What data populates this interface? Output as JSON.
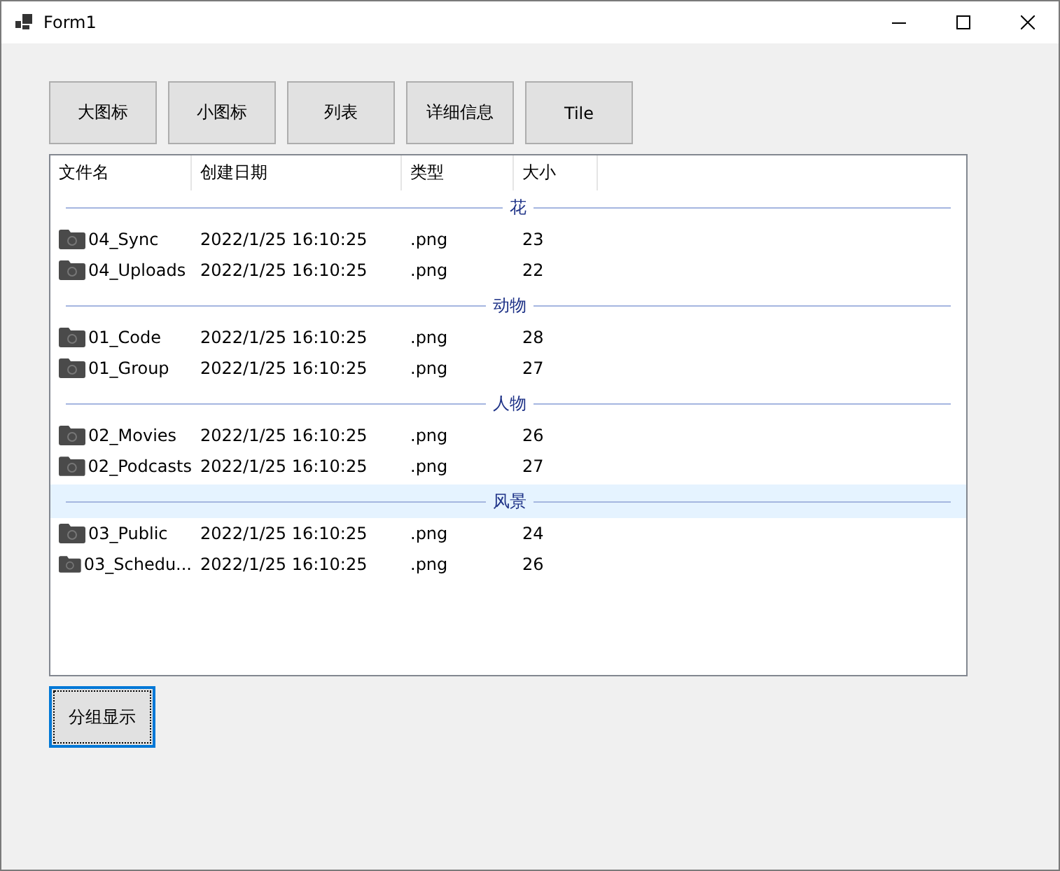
{
  "window": {
    "title": "Form1"
  },
  "view_buttons": [
    "大图标",
    "小图标",
    "列表",
    "详细信息",
    "Tile"
  ],
  "list_view": {
    "columns": [
      "文件名",
      "创建日期",
      "类型",
      "大小"
    ],
    "groups": [
      {
        "name": "花",
        "selected": false,
        "rows": [
          {
            "name": "04_Sync",
            "date": "2022/1/25 16:10:25",
            "type": ".png",
            "size": "23"
          },
          {
            "name": "04_Uploads",
            "date": "2022/1/25 16:10:25",
            "type": ".png",
            "size": "22"
          }
        ]
      },
      {
        "name": "动物",
        "selected": false,
        "rows": [
          {
            "name": "01_Code",
            "date": "2022/1/25 16:10:25",
            "type": ".png",
            "size": "28"
          },
          {
            "name": "01_Group",
            "date": "2022/1/25 16:10:25",
            "type": ".png",
            "size": "27"
          }
        ]
      },
      {
        "name": "人物",
        "selected": false,
        "rows": [
          {
            "name": "02_Movies",
            "date": "2022/1/25 16:10:25",
            "type": ".png",
            "size": "26"
          },
          {
            "name": "02_Podcasts",
            "date": "2022/1/25 16:10:25",
            "type": ".png",
            "size": "27"
          }
        ]
      },
      {
        "name": "风景",
        "selected": true,
        "rows": [
          {
            "name": "03_Public",
            "date": "2022/1/25 16:10:25",
            "type": ".png",
            "size": "24"
          },
          {
            "name": "03_Schedu...",
            "date": "2022/1/25 16:10:25",
            "type": ".png",
            "size": "26"
          }
        ]
      }
    ]
  },
  "group_button": {
    "label": "分组显示",
    "focused": true
  }
}
